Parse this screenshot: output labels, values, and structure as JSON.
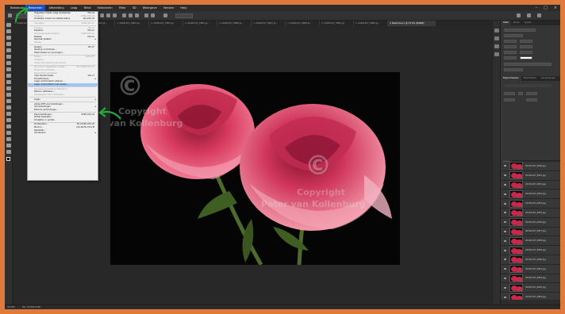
{
  "menubar": {
    "items": [
      "Bestand",
      "Bewerken",
      "Afbeelding",
      "Laag",
      "Tekst",
      "Selecteren",
      "Filter",
      "3D",
      "Weergave",
      "Venster",
      "Help"
    ],
    "active_index": 1
  },
  "tabs": [
    {
      "label": "× 20181107_0850.jp...",
      "active": false
    },
    {
      "label": "× 20181107_0851.jp...",
      "active": false
    },
    {
      "label": "× 20181107_0852.jp...",
      "active": false
    },
    {
      "label": "× 20181107_0853.jp...",
      "active": false
    },
    {
      "label": "× 20181107_0854.jp...",
      "active": false
    },
    {
      "label": "× 20181107_0855.jp...",
      "active": false
    },
    {
      "label": "× 20181107_0856.jp...",
      "active": false
    },
    {
      "label": "× 20181107_0857.jp...",
      "active": false
    },
    {
      "label": "× 20181107_0858.jp...",
      "active": false
    },
    {
      "label": "× 20181107_0859.jp...",
      "active": false
    },
    {
      "label": "× 20181107_0860.jp...",
      "active": false
    },
    {
      "label": "× Naamloos-1 @ 33,3% (RGB/8)",
      "active": true
    }
  ],
  "dropdown": {
    "items": [
      {
        "label": "Ongedaan maken Laag verwijderen",
        "shortcut": "Ctrl+Z",
        "disabled": false
      },
      {
        "label": "Opnieuw",
        "shortcut": "Shift+Ctrl+Z",
        "disabled": true
      },
      {
        "label": "Schakelen tussen de laatste status",
        "shortcut": "Alt+Ctrl+Z",
        "disabled": false
      },
      {
        "sep": true
      },
      {
        "label": "Vervagen...",
        "shortcut": "Shift+Ctrl+F",
        "disabled": true
      },
      {
        "sep": true
      },
      {
        "label": "Knippen",
        "shortcut": "Ctrl+X",
        "disabled": true
      },
      {
        "label": "Kopiëren",
        "shortcut": "Ctrl+C",
        "disabled": false
      },
      {
        "label": "Samengevoegd kopiëren",
        "shortcut": "Shift+Ctrl+C",
        "disabled": true
      },
      {
        "label": "Plakken",
        "shortcut": "Ctrl+V",
        "disabled": false
      },
      {
        "label": "Speciaal plakken",
        "shortcut": "",
        "disabled": false,
        "arrow": true
      },
      {
        "label": "Wissen",
        "shortcut": "",
        "disabled": true
      },
      {
        "sep": true
      },
      {
        "label": "Zoeken",
        "shortcut": "Ctrl+F",
        "disabled": false
      },
      {
        "label": "Spelling controleren...",
        "shortcut": "",
        "disabled": false
      },
      {
        "label": "Tekst zoeken en vervangen...",
        "shortcut": "",
        "disabled": false
      },
      {
        "sep": true
      },
      {
        "label": "Vullen...",
        "shortcut": "Shift+F5",
        "disabled": true
      },
      {
        "label": "Omlijnen...",
        "shortcut": "",
        "disabled": true
      },
      {
        "label": "Vullen met behoud van inhoud",
        "shortcut": "",
        "disabled": true
      },
      {
        "sep": true
      },
      {
        "label": "Op inhoud afgestemd schalen",
        "shortcut": "Alt+Shift+Ctrl+C",
        "disabled": true
      },
      {
        "label": "Marionet verdraaien",
        "shortcut": "",
        "disabled": true
      },
      {
        "label": "Perspectief verdraaien",
        "shortcut": "",
        "disabled": true
      },
      {
        "label": "Vrije transformatie",
        "shortcut": "Ctrl+T",
        "disabled": false
      },
      {
        "label": "Transformeren",
        "shortcut": "",
        "disabled": false,
        "arrow": true
      },
      {
        "label": "Lagen automatisch uitlijnen...",
        "shortcut": "",
        "disabled": false
      },
      {
        "label": "Lagen automatisch overvloeien...",
        "shortcut": "",
        "disabled": false,
        "highlight": true
      },
      {
        "sep": true
      },
      {
        "label": "Penseelvoorinstelling definiëren...",
        "shortcut": "",
        "disabled": true
      },
      {
        "label": "Patroon definiëren...",
        "shortcut": "",
        "disabled": false
      },
      {
        "label": "Aangepaste vorm definiëren...",
        "shortcut": "",
        "disabled": true
      },
      {
        "sep": true
      },
      {
        "label": "Legen",
        "shortcut": "",
        "disabled": false,
        "arrow": true
      },
      {
        "sep": true
      },
      {
        "label": "Adobe PDF-voorinstellingen...",
        "shortcut": "",
        "disabled": false
      },
      {
        "label": "Voorinstellingen",
        "shortcut": "",
        "disabled": false,
        "arrow": true
      },
      {
        "label": "Externe verbindingen...",
        "shortcut": "",
        "disabled": false
      },
      {
        "sep": true
      },
      {
        "label": "Kleurinstellingen...",
        "shortcut": "Shift+Ctrl+K",
        "disabled": false
      },
      {
        "label": "Profiel toewijzen...",
        "shortcut": "",
        "disabled": false
      },
      {
        "label": "Omzetten in profiel...",
        "shortcut": "",
        "disabled": false
      },
      {
        "sep": true
      },
      {
        "label": "Sneltoetsen...",
        "shortcut": "Alt+Shift+Ctrl+K",
        "disabled": false
      },
      {
        "label": "Menu's...",
        "shortcut": "Alt+Shift+Ctrl+M",
        "disabled": false
      },
      {
        "label": "Werkbalk...",
        "shortcut": "",
        "disabled": false
      },
      {
        "label": "Voorkeuren",
        "shortcut": "",
        "disabled": false,
        "arrow": true
      }
    ]
  },
  "watermark": {
    "symbol": "©",
    "line1": "Copyright",
    "line2": "Peter van Kollenburg"
  },
  "panels": {
    "top_tabs": [
      "Tekst",
      "Alinea",
      "Glyphs"
    ],
    "mid_tabs": [
      "Eigenschappen",
      "Bibliotheken",
      "Aanpassingen"
    ],
    "layers_tab": "Lagen",
    "layers_mode": "Normaal",
    "layers_kind": "Soort",
    "layer_names": [
      "20181107_0850.jpg",
      "20181107_0851.jpg",
      "20181107_0852.jpg",
      "20181107_0853.jpg",
      "20181107_0854.jpg",
      "20181107_0855.jpg",
      "20181107_0856.jpg",
      "20181107_0857.jpg",
      "20181107_0858.jpg",
      "20181107_0859.jpg",
      "20181107_0860.jpg",
      "20181107_0861.jpg",
      "20181107_0862.jpg",
      "20181107_0863.jpg",
      "20181107_0864.jpg"
    ]
  },
  "status": {
    "zoom": "33,33%",
    "doc": "Doc: 93,2M/1,03G"
  },
  "colors": {
    "outer": "#e07a3c",
    "highlight": "#9fc6f5",
    "rose": "#c8284a",
    "arrow": "#1fae3c"
  }
}
